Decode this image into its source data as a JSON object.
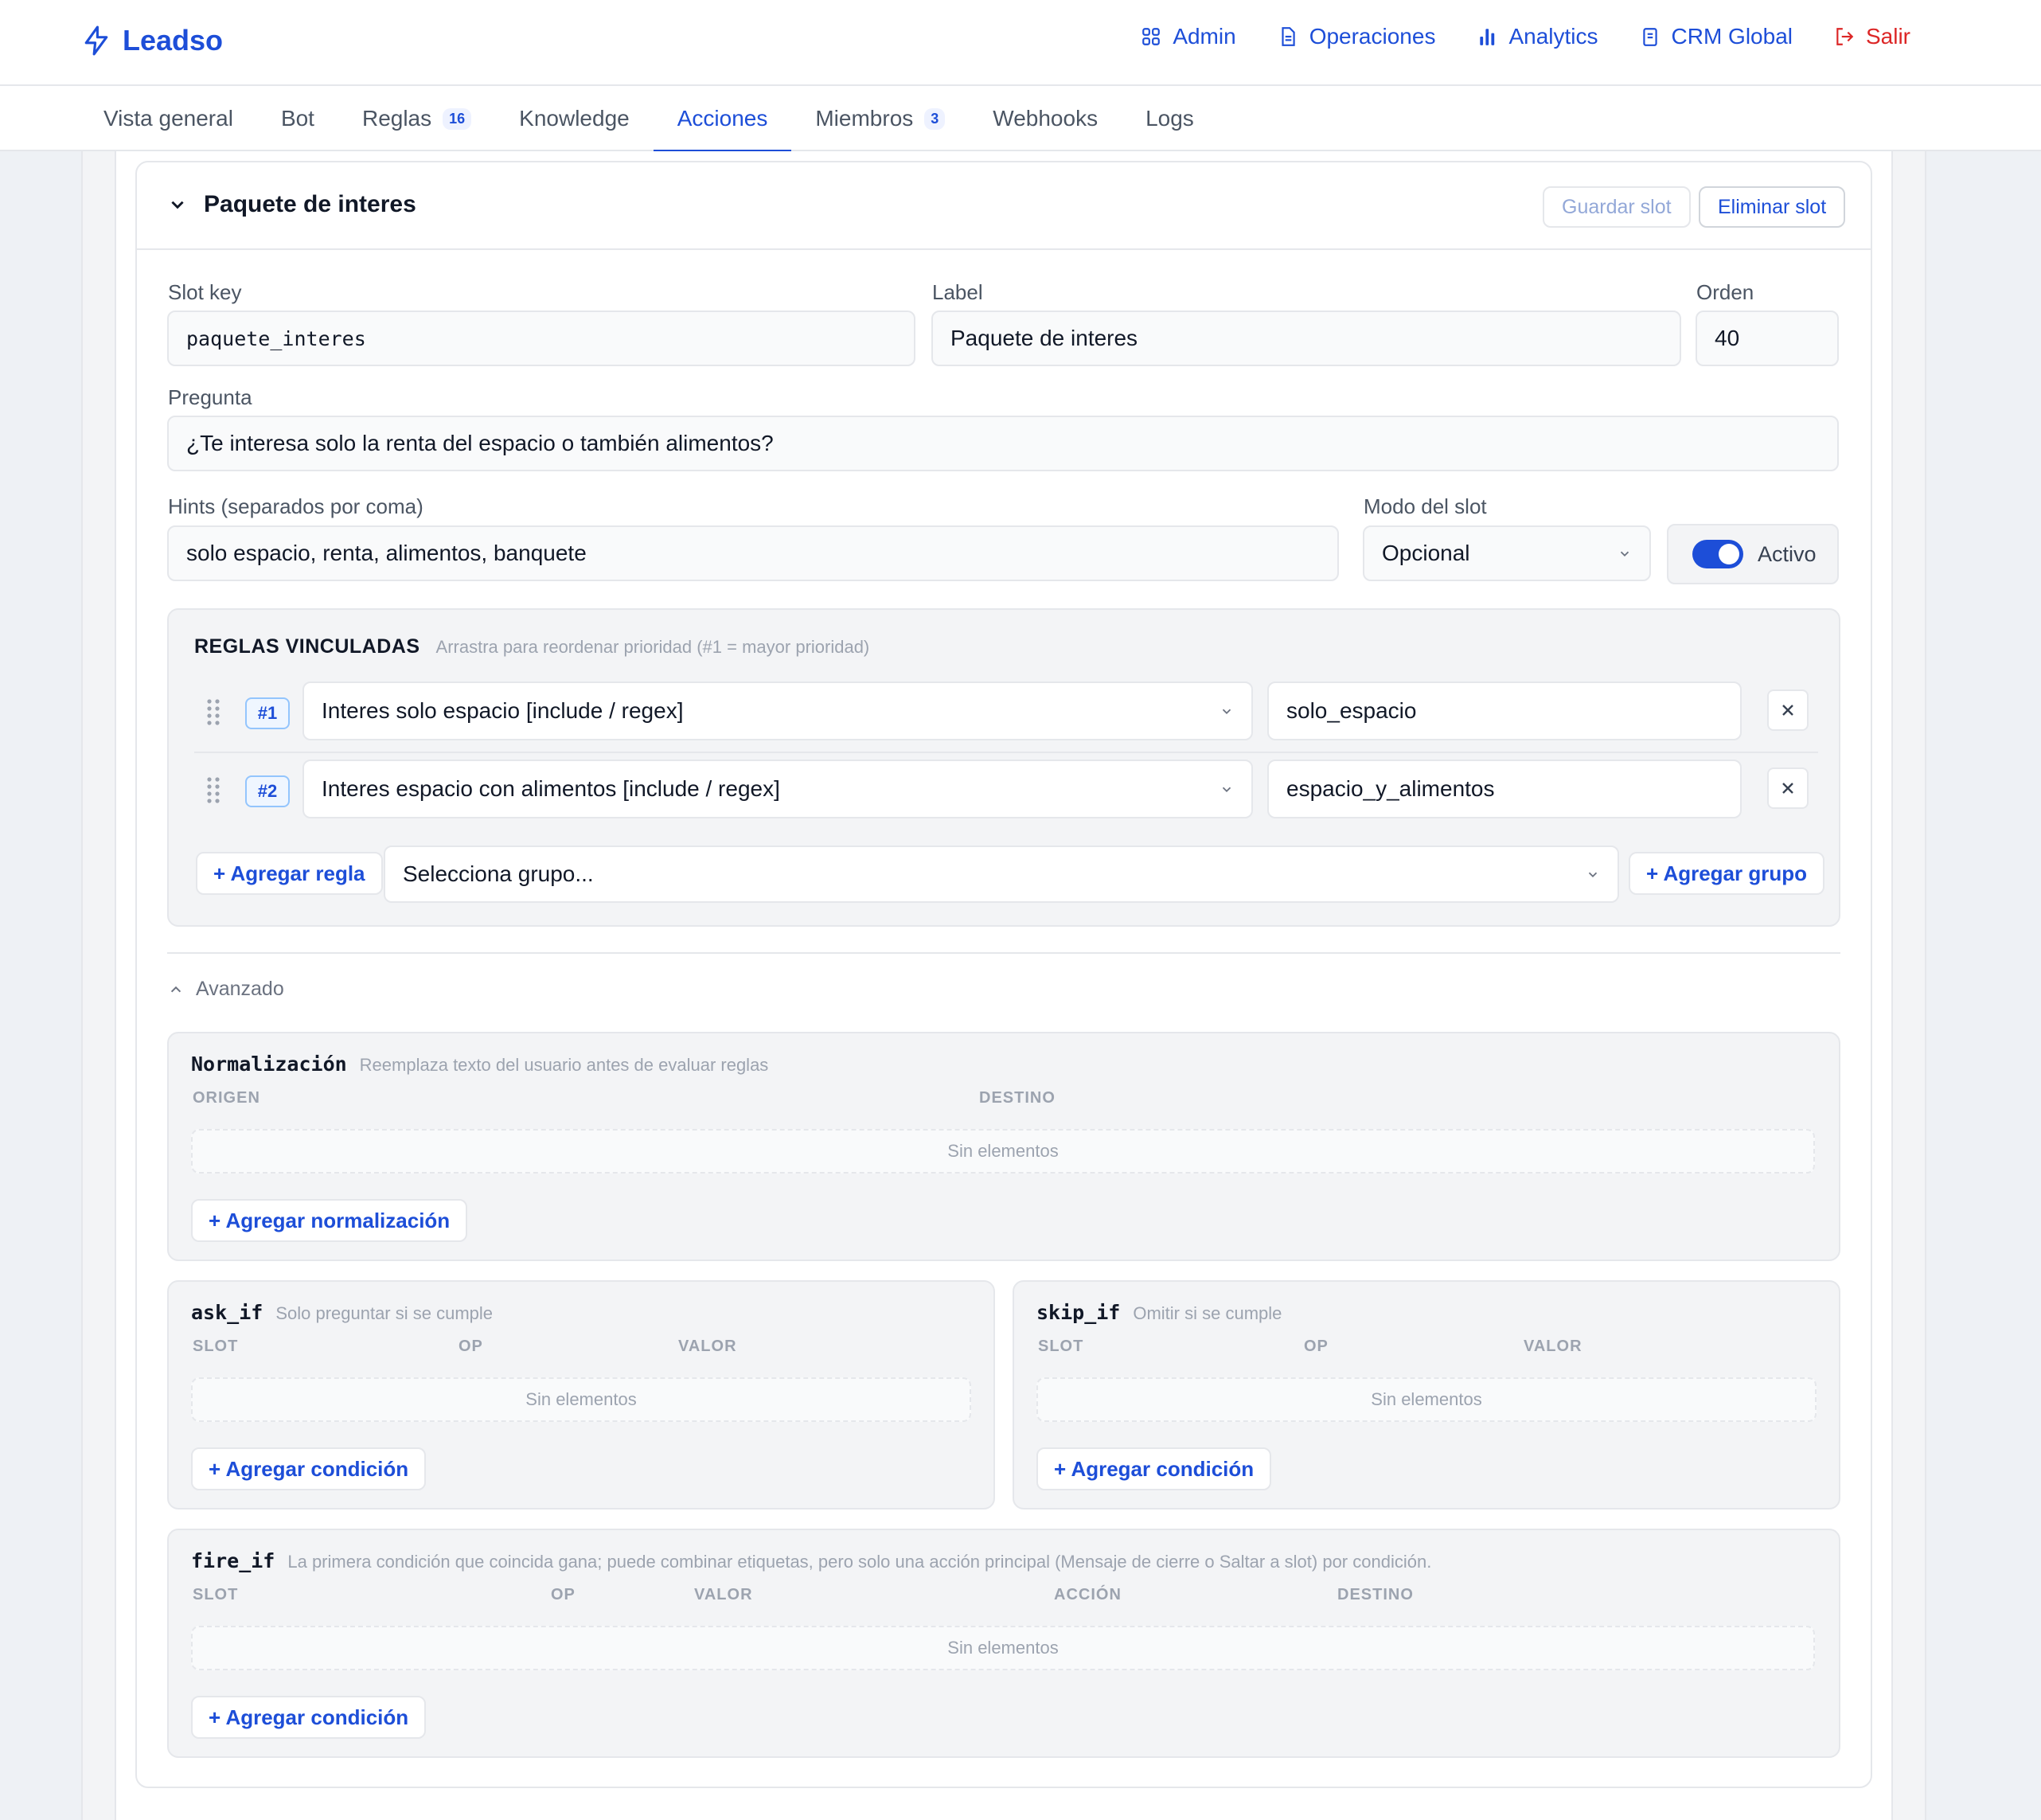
{
  "header": {
    "brand": "Leadso",
    "nav": [
      {
        "label": "Admin",
        "icon": "grid-icon"
      },
      {
        "label": "Operaciones",
        "icon": "document-icon"
      },
      {
        "label": "Analytics",
        "icon": "bar-chart-icon"
      },
      {
        "label": "CRM Global",
        "icon": "clipboard-icon"
      },
      {
        "label": "Salir",
        "icon": "logout-icon"
      }
    ]
  },
  "tabs": [
    {
      "label": "Vista general"
    },
    {
      "label": "Bot"
    },
    {
      "label": "Reglas",
      "badge": "16"
    },
    {
      "label": "Knowledge"
    },
    {
      "label": "Acciones",
      "active": true
    },
    {
      "label": "Miembros",
      "badge": "3"
    },
    {
      "label": "Webhooks"
    },
    {
      "label": "Logs"
    }
  ],
  "slot": {
    "title": "Paquete de interes",
    "save_label": "Guardar slot",
    "delete_label": "Eliminar slot",
    "slot_key_label": "Slot key",
    "slot_key": "paquete_interes",
    "label_label": "Label",
    "label_value": "Paquete de interes",
    "orden_label": "Orden",
    "orden_value": "40",
    "pregunta_label": "Pregunta",
    "pregunta_value": "¿Te interesa solo la renta del espacio o también alimentos?",
    "hints_label": "Hints (separados por coma)",
    "hints_value": "solo espacio, renta, alimentos, banquete",
    "modo_label": "Modo del slot",
    "modo_value": "Opcional",
    "activo_label": "Activo",
    "activo_on": true
  },
  "reglas": {
    "title": "REGLAS VINCULADAS",
    "subtitle": "Arrastra para reordenar prioridad (#1 = mayor prioridad)",
    "rows": [
      {
        "priority": "#1",
        "rule": "Interes solo espacio [include / regex]",
        "value": "solo_espacio"
      },
      {
        "priority": "#2",
        "rule": "Interes espacio con alimentos [include / regex]",
        "value": "espacio_y_alimentos"
      }
    ],
    "add_rule_label": "+ Agregar regla",
    "group_placeholder": "Selecciona grupo...",
    "add_group_label": "+ Agregar grupo"
  },
  "advanced": {
    "label": "Avanzado",
    "normalizacion": {
      "title": "Normalización",
      "subtitle": "Reemplaza texto del usuario antes de evaluar reglas",
      "columns": [
        "ORIGEN",
        "DESTINO"
      ],
      "empty": "Sin elementos",
      "add_label": "+ Agregar normalización"
    },
    "ask_if": {
      "title": "ask_if",
      "subtitle": "Solo preguntar si se cumple",
      "columns": [
        "SLOT",
        "OP",
        "VALOR"
      ],
      "empty": "Sin elementos",
      "add_label": "+ Agregar condición"
    },
    "skip_if": {
      "title": "skip_if",
      "subtitle": "Omitir si se cumple",
      "columns": [
        "SLOT",
        "OP",
        "VALOR"
      ],
      "empty": "Sin elementos",
      "add_label": "+ Agregar condición"
    },
    "fire_if": {
      "title": "fire_if",
      "subtitle": "La primera condición que coincida gana; puede combinar etiquetas, pero solo una acción principal (Mensaje de cierre o Saltar a slot) por condición.",
      "columns": [
        "SLOT",
        "OP",
        "VALOR",
        "ACCIÓN",
        "DESTINO"
      ],
      "empty": "Sin elementos",
      "add_label": "+ Agregar condición"
    }
  },
  "colors": {
    "accent": "#1d4ed8",
    "danger": "#dc2626"
  }
}
